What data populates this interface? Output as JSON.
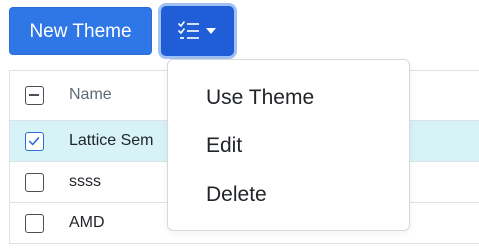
{
  "toolbar": {
    "new_theme_label": "New Theme",
    "actions_icon": "list-check-icon",
    "actions_caret_icon": "caret-down-icon"
  },
  "table": {
    "header": {
      "select_all_state": "indeterminate",
      "name_label": "Name"
    },
    "rows": [
      {
        "name": "Lattice Sem",
        "checked": true
      },
      {
        "name": "ssss",
        "checked": false
      },
      {
        "name": "AMD",
        "checked": false
      }
    ]
  },
  "dropdown": {
    "items": [
      {
        "label": "Use Theme"
      },
      {
        "label": "Edit"
      },
      {
        "label": "Delete"
      }
    ]
  },
  "colors": {
    "primary": "#2f77e6",
    "primary_active": "#1f5ed6",
    "selected_row": "#d7f3f8",
    "border": "#dee2e6"
  }
}
